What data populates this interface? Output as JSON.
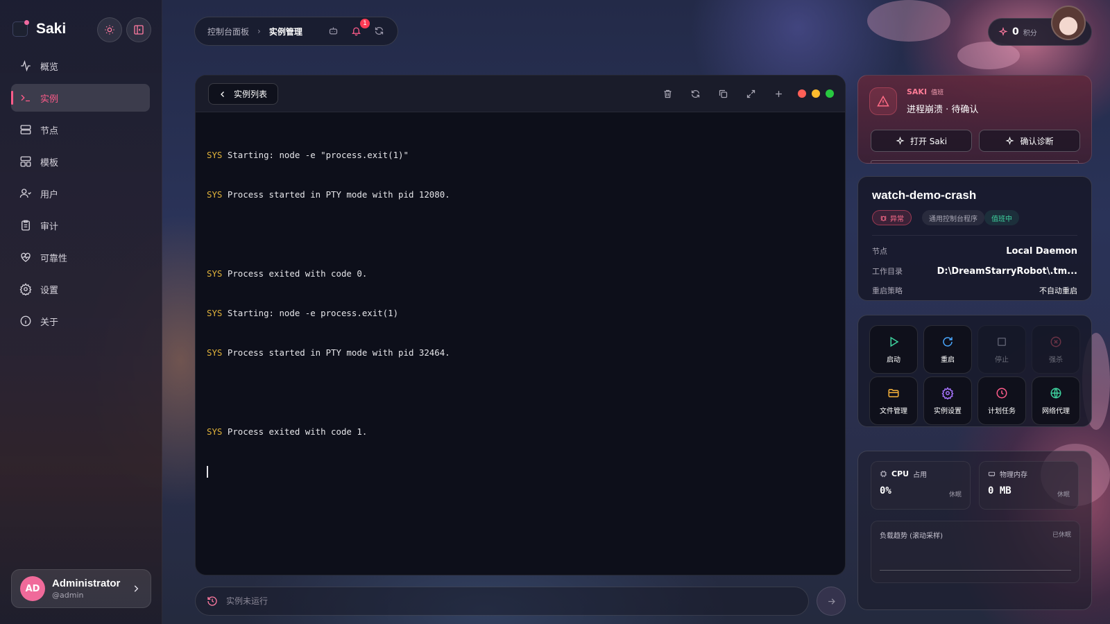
{
  "app": {
    "name": "Saki"
  },
  "sidebar": {
    "items": [
      {
        "label": "概览",
        "icon": "activity-icon"
      },
      {
        "label": "实例",
        "icon": "terminal-icon",
        "active": true
      },
      {
        "label": "节点",
        "icon": "server-icon"
      },
      {
        "label": "模板",
        "icon": "layout-icon"
      },
      {
        "label": "用户",
        "icon": "users-icon"
      },
      {
        "label": "审计",
        "icon": "clipboard-icon"
      },
      {
        "label": "可靠性",
        "icon": "heart-pulse-icon"
      },
      {
        "label": "设置",
        "icon": "gear-icon"
      },
      {
        "label": "关于",
        "icon": "info-icon"
      }
    ],
    "user": {
      "initials": "AD",
      "name": "Administrator",
      "handle": "@admin"
    }
  },
  "topbar": {
    "breadcrumb": [
      "控制台面板",
      "实例管理"
    ],
    "notification_count": "1",
    "points_value": "0",
    "points_unit": "积分"
  },
  "terminal": {
    "back_label": "实例列表",
    "lines": [
      {
        "tag": "SYS",
        "text": "Starting: node -e \"process.exit(1)\""
      },
      {
        "tag": "SYS",
        "text": "Process started in PTY mode with pid 12080."
      },
      {
        "tag": "",
        "text": ""
      },
      {
        "tag": "SYS",
        "text": "Process exited with code 0."
      },
      {
        "tag": "SYS",
        "text": "Starting: node -e process.exit(1)"
      },
      {
        "tag": "SYS",
        "text": "Process started in PTY mode with pid 32464."
      },
      {
        "tag": "",
        "text": ""
      },
      {
        "tag": "SYS",
        "text": "Process exited with code 1."
      }
    ],
    "window_dots": [
      "#ff5f57",
      "#febc2e",
      "#28c840"
    ]
  },
  "command": {
    "placeholder": "实例未运行"
  },
  "alert": {
    "source": "SAKI",
    "source_sub": "值班",
    "title": "进程崩溃 · 待确认",
    "open_label": "打开 Saki",
    "confirm_label": "确认诊断"
  },
  "instance": {
    "name": "watch-demo-crash",
    "status_tag": "异常",
    "type_tag": "通用控制台程序",
    "watch_tag": "值班中",
    "fields": [
      {
        "key": "节点",
        "value": "Local Daemon"
      },
      {
        "key": "工作目录",
        "value": "D:\\DreamStarryRobot\\.tm..."
      },
      {
        "key": "重启策略",
        "value": "不自动重启"
      }
    ]
  },
  "actions": [
    {
      "label": "启动",
      "icon": "play-icon",
      "color": "#3ed39f",
      "enabled": true
    },
    {
      "label": "重启",
      "icon": "restart-icon",
      "color": "#4aa8ff",
      "enabled": true
    },
    {
      "label": "停止",
      "icon": "stop-icon",
      "color": "#cfcfd8",
      "enabled": false
    },
    {
      "label": "强杀",
      "icon": "kill-icon",
      "color": "#ff5d6e",
      "enabled": false
    },
    {
      "label": "文件管理",
      "icon": "folder-icon",
      "color": "#f5b13a",
      "enabled": true
    },
    {
      "label": "实例设置",
      "icon": "settings-icon",
      "color": "#a774ff",
      "enabled": true
    },
    {
      "label": "计划任务",
      "icon": "clock-icon",
      "color": "#ff5c8a",
      "enabled": true
    },
    {
      "label": "网络代理",
      "icon": "globe-icon",
      "color": "#3ed39f",
      "enabled": true
    }
  ],
  "stats": {
    "cpu": {
      "label_bold": "CPU",
      "label": "占用",
      "value": "0%",
      "state": "休眠"
    },
    "mem": {
      "label": "物理内存",
      "value": "0 MB",
      "state": "休眠"
    },
    "trend": {
      "label": "负载趋势 (滚动采样)",
      "state": "已休眠"
    }
  }
}
